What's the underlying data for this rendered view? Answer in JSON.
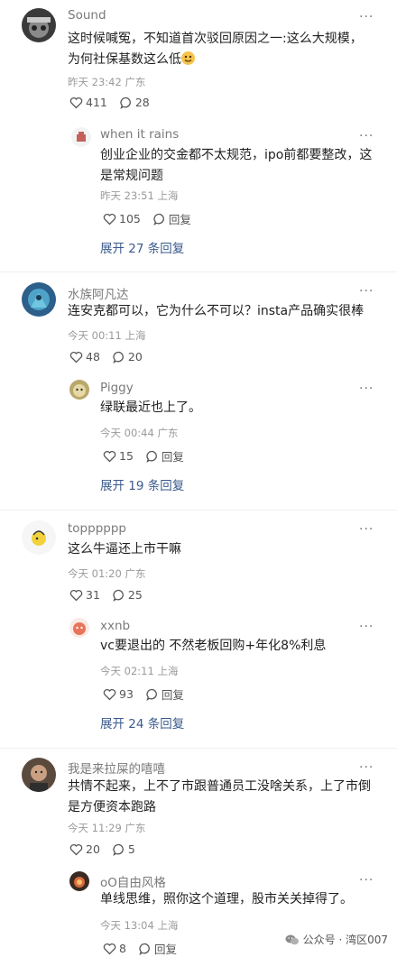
{
  "comments": [
    {
      "username": "Sound",
      "text": "这时候喊冤，不知道首次驳回原因之一:这么大规模，为何社保基数这么低",
      "emoji": "face-emoji",
      "meta": "昨天 23:42 广东",
      "likes": "411",
      "replies_count": "28",
      "reply": {
        "username": "when it rains",
        "text": "创业企业的交金都不太规范，ipo前都要整改，这是常规问题",
        "meta": "昨天 23:51 上海",
        "likes": "105",
        "reply_label": "回复"
      },
      "expand": "展开 27 条回复"
    },
    {
      "username": "水族阿凡达",
      "text": "连安克都可以，它为什么不可以？insta产品确实很棒",
      "meta": "今天 00:11 上海",
      "likes": "48",
      "replies_count": "20",
      "reply": {
        "username": "Piggy",
        "text": "绿联最近也上了。",
        "meta": "今天 00:44 广东",
        "likes": "15",
        "reply_label": "回复"
      },
      "expand": "展开 19 条回复"
    },
    {
      "username": "topppppp",
      "text": "这么牛逼还上市干嘛",
      "meta": "今天 01:20 广东",
      "likes": "31",
      "replies_count": "25",
      "reply": {
        "username": "xxnb",
        "text": "vc要退出的 不然老板回购+年化8%利息",
        "meta": "今天 02:11 上海",
        "likes": "93",
        "reply_label": "回复"
      },
      "expand": "展开 24 条回复"
    },
    {
      "username": "我是来拉屎的嘻嘻",
      "text": "共情不起来，上不了市跟普通员工没啥关系，上了市倒是方便资本跑路",
      "meta": "今天 11:29 广东",
      "likes": "20",
      "replies_count": "5",
      "reply": {
        "username": "oO自由风格",
        "text": "单线思维，照你这个道理，股市关关掉得了。",
        "meta": "今天 13:04 上海",
        "likes": "8",
        "reply_label": "回复"
      }
    }
  ],
  "watermark": {
    "label": "公众号 · 湾区007",
    "icon": "wechat-icon"
  },
  "colors": {
    "username": "#7a7a7a",
    "meta": "#9a9a9a",
    "expand_link": "#3a5a8c"
  }
}
